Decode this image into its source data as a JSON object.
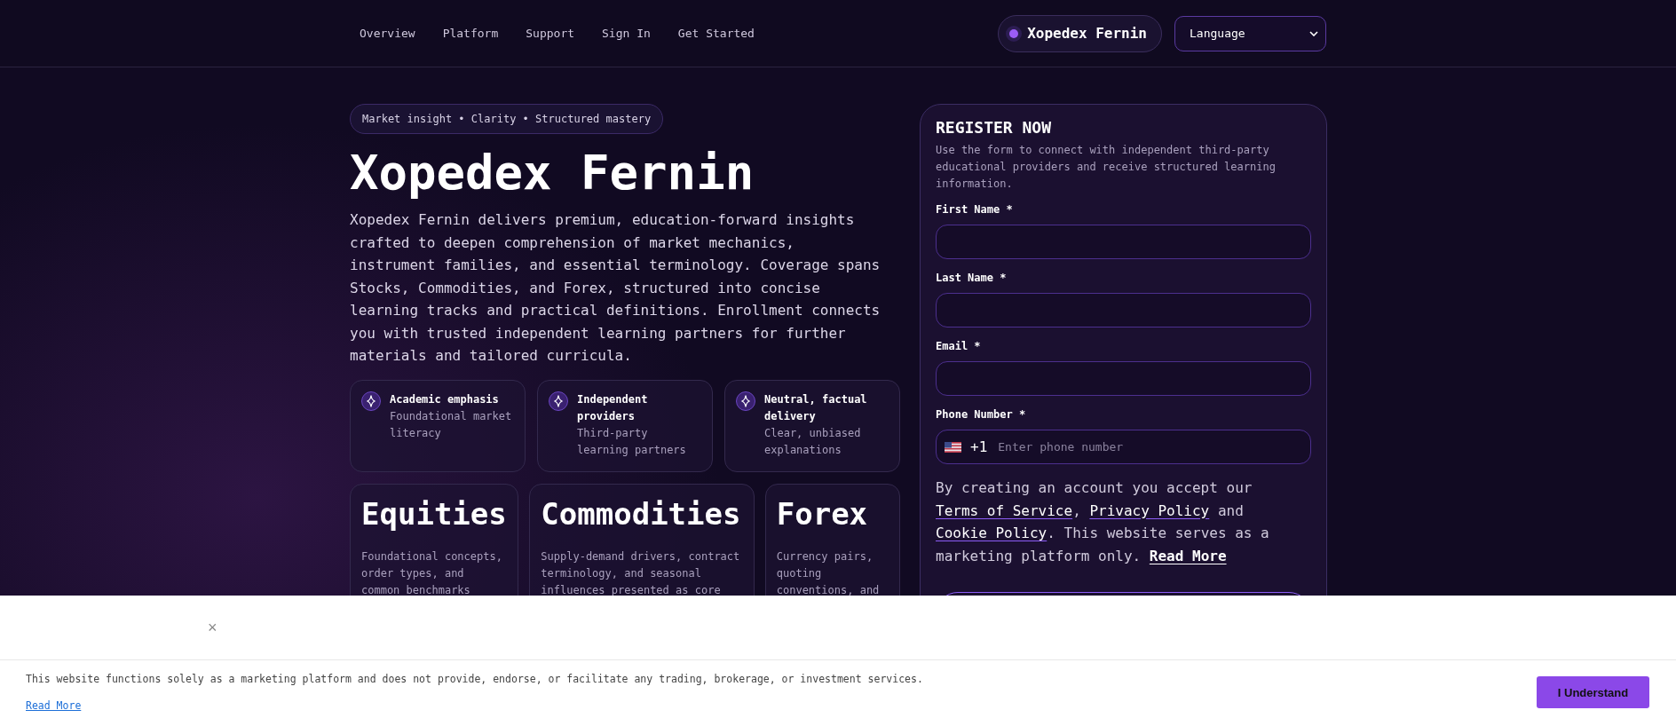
{
  "nav": {
    "links": [
      "Overview",
      "Platform",
      "Support",
      "Sign In",
      "Get Started"
    ],
    "brand": "Xopedex Fernin",
    "language": "Language"
  },
  "hero": {
    "tagline": "Market insight • Clarity • Structured mastery",
    "title": "Xopedex Fernin",
    "intro": "Xopedex Fernin delivers premium, education-forward insights crafted to deepen comprehension of market mechanics, instrument families, and essential terminology. Coverage spans Stocks, Commodities, and Forex, structured into concise learning tracks and practical definitions. Enrollment connects you with trusted independent learning partners for further materials and tailored curricula."
  },
  "features": [
    {
      "title": "Academic emphasis",
      "text": "Foundational market literacy"
    },
    {
      "title": "Independent providers",
      "text": "Third-party learning partners"
    },
    {
      "title": "Neutral, factual delivery",
      "text": "Clear, unbiased explanations"
    }
  ],
  "markets": [
    {
      "title": "Equities",
      "text": "Foundational concepts, order types, and common benchmarks"
    },
    {
      "title": "Commodities",
      "text": "Supply-demand drivers, contract terminology, and seasonal influences presented as core"
    },
    {
      "title": "Forex",
      "text": "Currency pairs, quoting conventions, and"
    }
  ],
  "form": {
    "heading": "REGISTER NOW",
    "description": "Use the form to connect with independent third-party educational providers and receive structured learning information.",
    "fields": [
      {
        "kind": "text",
        "label": "First Name *"
      },
      {
        "kind": "text",
        "label": "Last Name *"
      },
      {
        "kind": "text",
        "label": "Email *"
      },
      {
        "kind": "phone",
        "label": "Phone Number *",
        "code": "+1",
        "placeholder": "Enter phone number"
      }
    ],
    "consent": [
      {
        "kind": "text",
        "text": "By creating an account you accept our "
      },
      {
        "kind": "link",
        "text": "Terms of Service"
      },
      {
        "kind": "text",
        "text": ", "
      },
      {
        "kind": "link",
        "text": "Privacy Policy"
      },
      {
        "kind": "text",
        "text": " and "
      },
      {
        "kind": "link",
        "text": "Cookie Policy"
      },
      {
        "kind": "text",
        "text": ". This website serves as a marketing platform only. "
      },
      {
        "kind": "strong-link",
        "text": "Read More"
      }
    ]
  },
  "cookie": {
    "close": "×",
    "text": "This website functions solely as a marketing platform and does not provide, endorse, or facilitate any trading, brokerage, or investment services.",
    "link": "Read More",
    "button": "I Understand"
  }
}
